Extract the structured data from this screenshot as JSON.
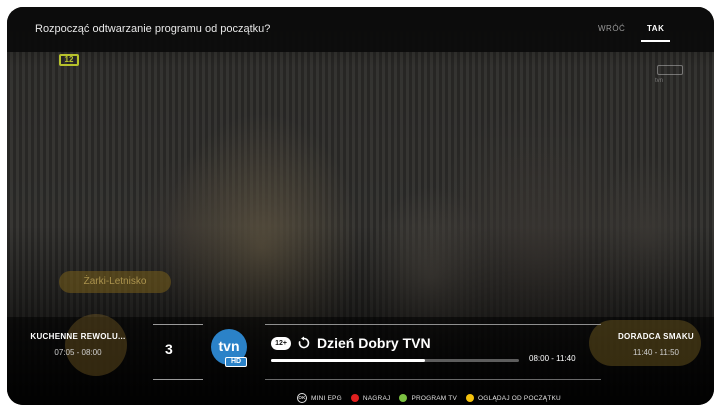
{
  "prompt": {
    "question": "Rozpocząć odtwarzanie programu od początku?",
    "back_label": "WRÓĆ",
    "yes_label": "TAK"
  },
  "footage": {
    "age_badge": "12",
    "lower_third": "Żarki-Letnisko"
  },
  "banner": {
    "previous": {
      "title": "KUCHENNE REWOLU...",
      "time": "07:05 - 08:00"
    },
    "next": {
      "title": "DORADCA SMAKU",
      "time": "11:40 - 11:50"
    },
    "channel": {
      "number": "3",
      "logo_text": "tvn",
      "hd_text": "HD",
      "logo_color": "#2b82c8"
    },
    "current": {
      "age_rating": "12+",
      "title": "Dzień Dobry TVN",
      "time": "08:00 - 11:40",
      "progress": 0.62
    }
  },
  "legend": {
    "ok_key": "OK",
    "items": [
      {
        "label": "MINI EPG",
        "icon": "ok-key"
      },
      {
        "label": "NAGRAJ",
        "color": "#e0201f"
      },
      {
        "label": "PROGRAM TV",
        "color": "#7cc142"
      },
      {
        "label": "OGLĄDAJ OD POCZĄTKU",
        "color": "#f4c20d"
      }
    ]
  }
}
